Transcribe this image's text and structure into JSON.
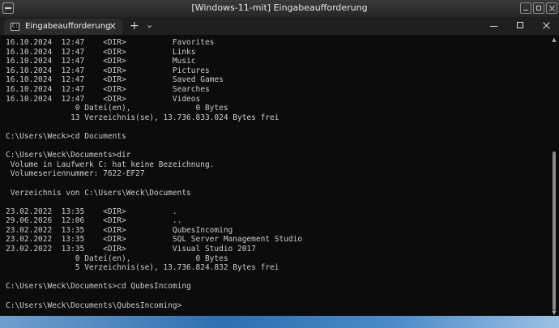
{
  "outer_window": {
    "title": "[Windows-11-mit] Eingabeaufforderung"
  },
  "tab": {
    "label": "Eingabeaufforderung",
    "icon": "cmd-icon",
    "close": "×"
  },
  "tabbar": {
    "new_tab": "+",
    "dropdown": "⌄"
  },
  "console_lines": [
    "16.10.2024  12:47    <DIR>          Favorites",
    "16.10.2024  12:47    <DIR>          Links",
    "16.10.2024  12:47    <DIR>          Music",
    "16.10.2024  12:47    <DIR>          Pictures",
    "16.10.2024  12:47    <DIR>          Saved Games",
    "16.10.2024  12:47    <DIR>          Searches",
    "16.10.2024  12:47    <DIR>          Videos",
    "               0 Datei(en),              0 Bytes",
    "              13 Verzeichnis(se), 13.736.833.024 Bytes frei",
    "",
    "C:\\Users\\Weck>cd Documents",
    "",
    "C:\\Users\\Weck\\Documents>dir",
    " Volume in Laufwerk C: hat keine Bezeichnung.",
    " Volumeseriennummer: 7622-EF27",
    "",
    " Verzeichnis von C:\\Users\\Weck\\Documents",
    "",
    "23.02.2022  13:35    <DIR>          .",
    "29.06.2026  12:06    <DIR>          ..",
    "23.02.2022  13:35    <DIR>          QubesIncoming",
    "23.02.2022  13:35    <DIR>          SQL Server Management Studio",
    "23.02.2022  13:35    <DIR>          Visual Studio 2017",
    "               0 Datei(en),              0 Bytes",
    "               5 Verzeichnis(se), 13.736.824.832 Bytes frei",
    "",
    "C:\\Users\\Weck\\Documents>cd QubesIncoming",
    "",
    "C:\\Users\\Weck\\Documents\\QubesIncoming>"
  ],
  "colors": {
    "console_bg": "#0c0c0c",
    "console_fg": "#cccccc",
    "tabbar_bg": "#1f1f1f",
    "tab_active_bg": "#2c2c2c"
  }
}
